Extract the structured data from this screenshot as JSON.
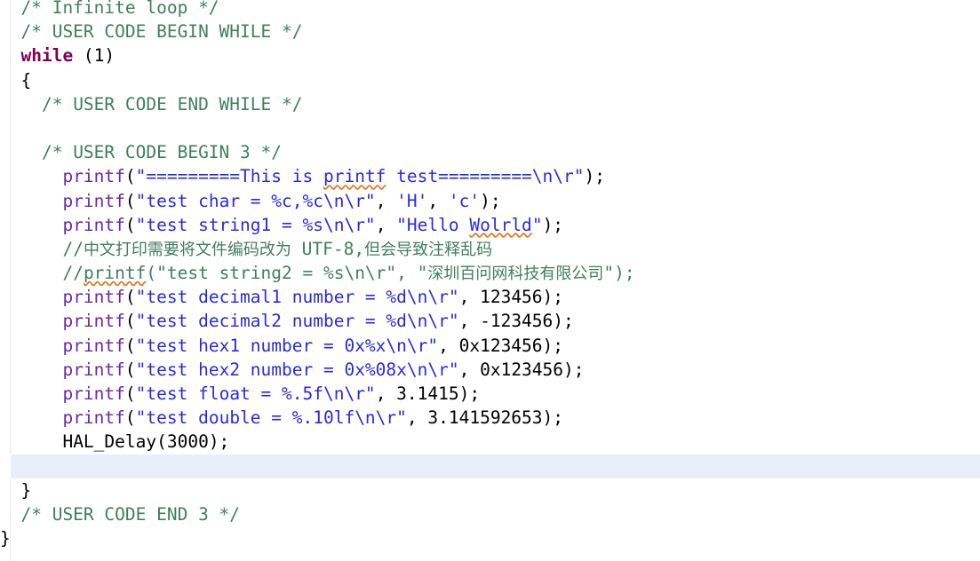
{
  "editor": {
    "language": "c",
    "theme": "light",
    "colors": {
      "background": "#ffffff",
      "comment": "#3f7f5f",
      "keyword": "#7f0055",
      "function": "#6a29a8",
      "string": "#2a2ae0",
      "plain": "#000000",
      "current_line_highlight": "#e8effa",
      "spellcheck_squiggle": "#e08030",
      "gutter_rule": "#e4e4ec"
    },
    "current_line_index": 18
  },
  "lines": [
    {
      "indent": "  ",
      "clipped_top": true,
      "current": false,
      "tokens": [
        {
          "cls": "cmt",
          "text": "/* Infinite loop */"
        }
      ]
    },
    {
      "indent": "  ",
      "current": false,
      "tokens": [
        {
          "cls": "cmt",
          "text": "/* USER CODE BEGIN WHILE */"
        }
      ]
    },
    {
      "indent": "  ",
      "current": false,
      "tokens": [
        {
          "cls": "kw",
          "text": "while"
        },
        {
          "cls": "pun",
          "text": " (1)"
        }
      ]
    },
    {
      "indent": "  ",
      "current": false,
      "tokens": [
        {
          "cls": "pun",
          "text": "{"
        }
      ]
    },
    {
      "indent": "    ",
      "current": false,
      "tokens": [
        {
          "cls": "cmt",
          "text": "/* USER CODE END WHILE */"
        }
      ]
    },
    {
      "indent": "",
      "current": false,
      "tokens": []
    },
    {
      "indent": "    ",
      "current": false,
      "tokens": [
        {
          "cls": "cmt",
          "text": "/* USER CODE BEGIN 3 */"
        }
      ]
    },
    {
      "indent": "      ",
      "current": false,
      "tokens": [
        {
          "cls": "fn",
          "text": "printf"
        },
        {
          "cls": "pun",
          "text": "("
        },
        {
          "cls": "str",
          "text": "\"=========This is "
        },
        {
          "cls": "str sq",
          "text": "printf"
        },
        {
          "cls": "str",
          "text": " test=========\\n\\r\""
        },
        {
          "cls": "pun",
          "text": ");"
        }
      ]
    },
    {
      "indent": "      ",
      "current": false,
      "tokens": [
        {
          "cls": "fn",
          "text": "printf"
        },
        {
          "cls": "pun",
          "text": "("
        },
        {
          "cls": "str",
          "text": "\"test char = %c,%c\\n\\r\""
        },
        {
          "cls": "pun",
          "text": ", "
        },
        {
          "cls": "str",
          "text": "'H'"
        },
        {
          "cls": "pun",
          "text": ", "
        },
        {
          "cls": "str",
          "text": "'c'"
        },
        {
          "cls": "pun",
          "text": ");"
        }
      ]
    },
    {
      "indent": "      ",
      "current": false,
      "tokens": [
        {
          "cls": "fn",
          "text": "printf"
        },
        {
          "cls": "pun",
          "text": "("
        },
        {
          "cls": "str",
          "text": "\"test string1 = %s\\n\\r\""
        },
        {
          "cls": "pun",
          "text": ", "
        },
        {
          "cls": "str",
          "text": "\"Hello "
        },
        {
          "cls": "str sq",
          "text": "Wolrld"
        },
        {
          "cls": "str",
          "text": "\""
        },
        {
          "cls": "pun",
          "text": ");"
        }
      ]
    },
    {
      "indent": "      ",
      "current": false,
      "tokens": [
        {
          "cls": "cmt",
          "text": "//"
        },
        {
          "cls": "cmt cjk",
          "text": "中文打印需要将文件编码改为"
        },
        {
          "cls": "cmt",
          "text": " UTF-8,"
        },
        {
          "cls": "cmt cjk",
          "text": "但会导致注释乱码"
        }
      ]
    },
    {
      "indent": "      ",
      "current": false,
      "tokens": [
        {
          "cls": "cmt",
          "text": "//"
        },
        {
          "cls": "cmt sq",
          "text": "printf"
        },
        {
          "cls": "cmt",
          "text": "(\"test string2 = %s\\n\\r\", \""
        },
        {
          "cls": "cmt cjk",
          "text": "深圳百问网科技有限公司"
        },
        {
          "cls": "cmt",
          "text": "\");"
        }
      ]
    },
    {
      "indent": "      ",
      "current": false,
      "tokens": [
        {
          "cls": "fn",
          "text": "printf"
        },
        {
          "cls": "pun",
          "text": "("
        },
        {
          "cls": "str",
          "text": "\"test decimal1 number = %d\\n\\r\""
        },
        {
          "cls": "pun",
          "text": ", "
        },
        {
          "cls": "num",
          "text": "123456"
        },
        {
          "cls": "pun",
          "text": ");"
        }
      ]
    },
    {
      "indent": "      ",
      "current": false,
      "tokens": [
        {
          "cls": "fn",
          "text": "printf"
        },
        {
          "cls": "pun",
          "text": "("
        },
        {
          "cls": "str",
          "text": "\"test decimal2 number = %d\\n\\r\""
        },
        {
          "cls": "pun",
          "text": ", "
        },
        {
          "cls": "num",
          "text": "-123456"
        },
        {
          "cls": "pun",
          "text": ");"
        }
      ]
    },
    {
      "indent": "      ",
      "current": false,
      "tokens": [
        {
          "cls": "fn",
          "text": "printf"
        },
        {
          "cls": "pun",
          "text": "("
        },
        {
          "cls": "str",
          "text": "\"test hex1 number = 0x%x\\n\\r\""
        },
        {
          "cls": "pun",
          "text": ", "
        },
        {
          "cls": "num",
          "text": "0x123456"
        },
        {
          "cls": "pun",
          "text": ");"
        }
      ]
    },
    {
      "indent": "      ",
      "current": false,
      "tokens": [
        {
          "cls": "fn",
          "text": "printf"
        },
        {
          "cls": "pun",
          "text": "("
        },
        {
          "cls": "str",
          "text": "\"test hex2 number = 0x%08x\\n\\r\""
        },
        {
          "cls": "pun",
          "text": ", "
        },
        {
          "cls": "num",
          "text": "0x123456"
        },
        {
          "cls": "pun",
          "text": ");"
        }
      ]
    },
    {
      "indent": "      ",
      "current": false,
      "tokens": [
        {
          "cls": "fn",
          "text": "printf"
        },
        {
          "cls": "pun",
          "text": "("
        },
        {
          "cls": "str",
          "text": "\"test float = %.5f\\n\\r\""
        },
        {
          "cls": "pun",
          "text": ", "
        },
        {
          "cls": "num",
          "text": "3.1415"
        },
        {
          "cls": "pun",
          "text": ");"
        }
      ]
    },
    {
      "indent": "      ",
      "current": false,
      "tokens": [
        {
          "cls": "fn",
          "text": "printf"
        },
        {
          "cls": "pun",
          "text": "("
        },
        {
          "cls": "str",
          "text": "\"test double = %.10lf\\n\\r\""
        },
        {
          "cls": "pun",
          "text": ", "
        },
        {
          "cls": "num",
          "text": "3.141592653"
        },
        {
          "cls": "pun",
          "text": ");"
        }
      ]
    },
    {
      "indent": "      ",
      "current": false,
      "tokens": [
        {
          "cls": "plain",
          "text": "HAL_Delay(3000);"
        }
      ]
    },
    {
      "indent": "",
      "current": true,
      "tokens": []
    },
    {
      "indent": "  ",
      "current": false,
      "tokens": [
        {
          "cls": "pun",
          "text": "}"
        }
      ]
    },
    {
      "indent": "  ",
      "current": false,
      "tokens": [
        {
          "cls": "cmt",
          "text": "/* USER CODE END 3 */"
        }
      ]
    },
    {
      "indent": "",
      "current": false,
      "tokens": [
        {
          "cls": "pun",
          "text": "}"
        }
      ]
    }
  ]
}
